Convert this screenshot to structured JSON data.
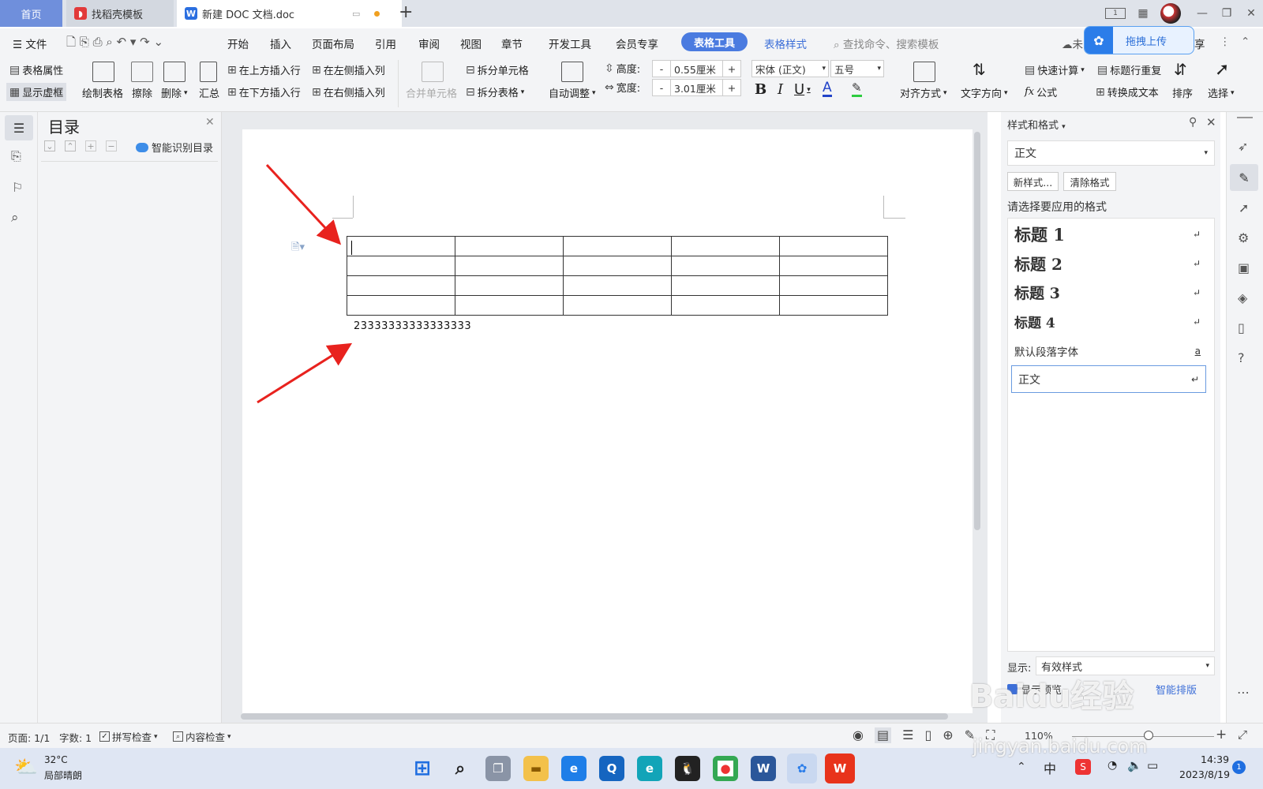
{
  "tabs": {
    "home": "首页",
    "template": "找稻壳模板",
    "document": "新建 DOC 文档.doc"
  },
  "menu": {
    "file": "文件",
    "items": [
      "开始",
      "插入",
      "页面布局",
      "引用",
      "审阅",
      "视图",
      "章节",
      "开发工具",
      "会员专享"
    ],
    "active_tool": "表格工具",
    "table_style": "表格样式",
    "search_placeholder": "查找命令、搜索模板",
    "upload": "拖拽上传",
    "share_fragment": "享",
    "cloud_fragment": "未"
  },
  "ribbon": {
    "table_props": "表格属性",
    "show_gridlines": "显示虚框",
    "draw_table": "绘制表格",
    "erase": "擦除",
    "delete": "删除",
    "summary": "汇总",
    "insert_above": "在上方插入行",
    "insert_below": "在下方插入行",
    "insert_left": "在左侧插入列",
    "insert_right": "在右侧插入列",
    "merge_cells": "合并单元格",
    "split_cells": "拆分单元格",
    "split_table": "拆分表格",
    "auto_fit": "自动调整",
    "height_label": "高度:",
    "height_value": "0.55厘米",
    "width_label": "宽度:",
    "width_value": "3.01厘米",
    "font_name": "宋体 (正文)",
    "font_size": "五号",
    "bold": "B",
    "italic": "I",
    "underline": "U",
    "font_color": "A",
    "align": "对齐方式",
    "text_direction": "文字方向",
    "quick_calc": "快速计算",
    "repeat_header": "标题行重复",
    "formula": "公式",
    "convert_text": "转换成文本",
    "sort": "排序",
    "select": "选择",
    "minus": "-",
    "plus": "+"
  },
  "nav": {
    "title": "目录",
    "smart_toc": "智能识别目录"
  },
  "document": {
    "table": {
      "rows": 4,
      "cols": 5
    },
    "text_below": "23333333333333333"
  },
  "styles_panel": {
    "title": "样式和格式",
    "current": "正文",
    "new_style": "新样式...",
    "clear_format": "清除格式",
    "prompt": "请选择要应用的格式",
    "items": [
      {
        "label": "标题  1",
        "mark": "↵"
      },
      {
        "label": "标题  2",
        "mark": "↵"
      },
      {
        "label": "标题  3",
        "mark": "↵"
      },
      {
        "label": "标题  4",
        "mark": "↵"
      },
      {
        "label": "默认段落字体",
        "mark": "a"
      },
      {
        "label": "正文",
        "mark": "↵"
      }
    ],
    "show_label": "显示:",
    "show_value": "有效样式",
    "show_preview": "显示预览",
    "smart_layout": "智能排版"
  },
  "status": {
    "page": "页面: 1/1",
    "words": "字数: 1",
    "spell_check": "拼写检查",
    "content_check": "内容检查",
    "zoom": "110%"
  },
  "taskbar": {
    "weather_temp": "32°C",
    "weather_desc": "局部晴朗",
    "ime": "中",
    "time": "14:39",
    "date": "2023/8/19",
    "notifications": "1"
  },
  "watermark": {
    "logo": "Baidu经验",
    "url": "jingyan.baidu.com"
  },
  "colors": {
    "accent": "#3d6fd8",
    "arrow": "#e8221e",
    "active_tab": "#4a7be0"
  }
}
